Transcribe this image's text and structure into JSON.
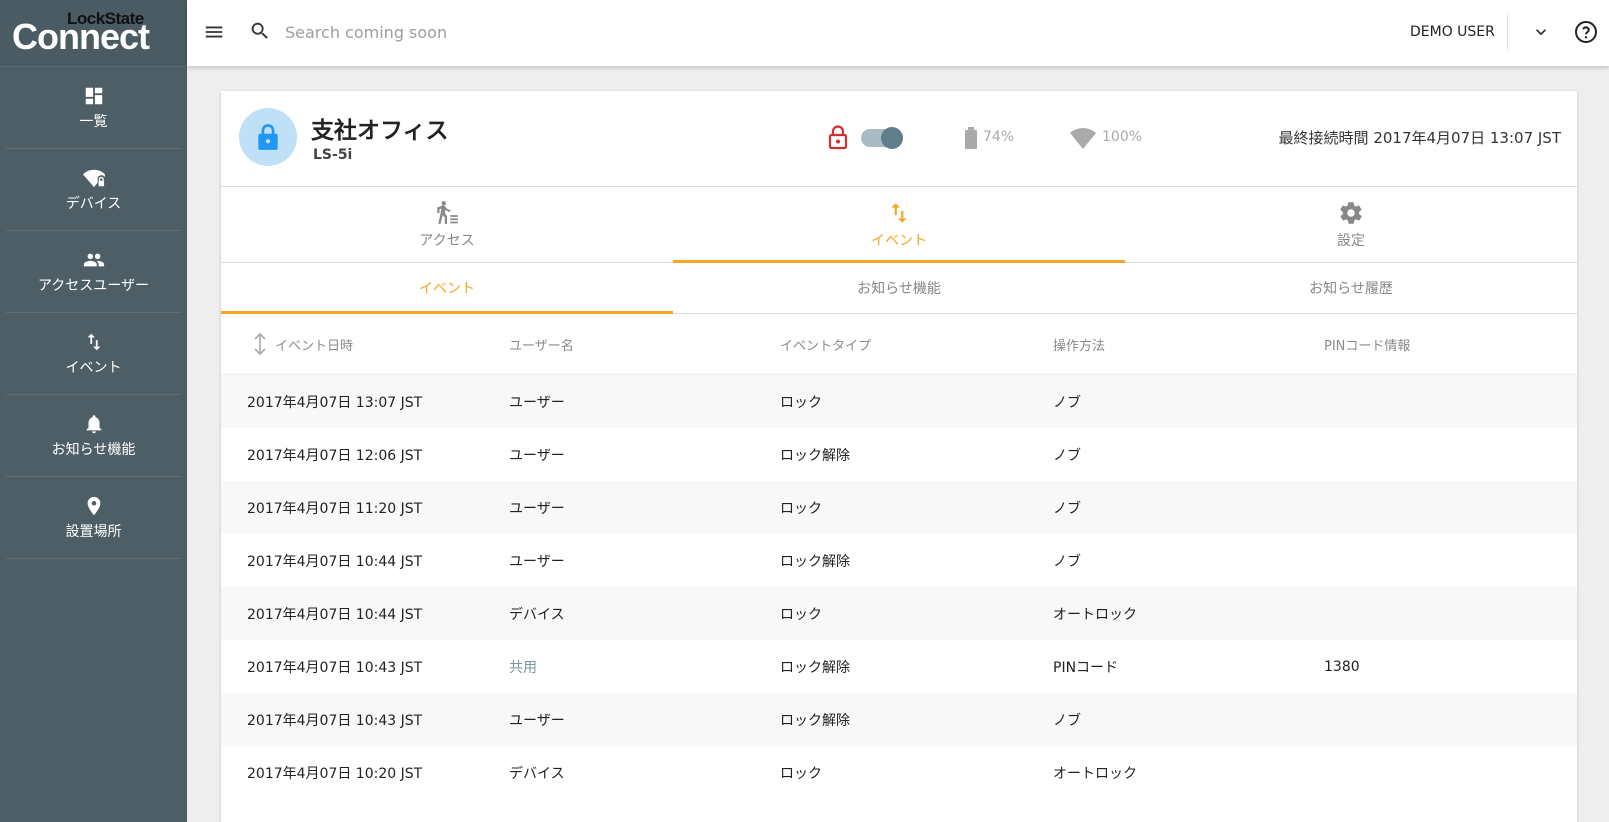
{
  "app": {
    "logo_top": "LockState",
    "logo_main": "Connect"
  },
  "sidebar": {
    "items": [
      {
        "label": "一覧",
        "icon": "dashboard-icon"
      },
      {
        "label": "デバイス",
        "icon": "wifi-lock-icon"
      },
      {
        "label": "アクセスユーザー",
        "icon": "people-icon"
      },
      {
        "label": "イベント",
        "icon": "swap-vert-icon"
      },
      {
        "label": "お知らせ機能",
        "icon": "bell-icon"
      },
      {
        "label": "設置場所",
        "icon": "location-pin-icon"
      }
    ]
  },
  "topbar": {
    "search_placeholder": "Search coming soon",
    "user": "DEMO USER"
  },
  "device": {
    "name": "支社オフィス",
    "model": "LS-5i",
    "battery": "74%",
    "signal": "100%",
    "last_connection": "最終接続時間 2017年4月07日 13:07 JST",
    "locked": true
  },
  "main_tabs": [
    {
      "label": "アクセス",
      "icon": "person-access-icon",
      "active": false
    },
    {
      "label": "イベント",
      "icon": "swap-vert-icon",
      "active": true
    },
    {
      "label": "設定",
      "icon": "gear-icon",
      "active": false
    }
  ],
  "sub_tabs": [
    {
      "label": "イベント",
      "active": true
    },
    {
      "label": "お知らせ機能",
      "active": false
    },
    {
      "label": "お知らせ履歴",
      "active": false
    }
  ],
  "table": {
    "columns": [
      "イベント日時",
      "ユーザー名",
      "イベントタイプ",
      "操作方法",
      "PINコード情報"
    ],
    "rows": [
      [
        "2017年4月07日 13:07 JST",
        "ユーザー",
        "ロック",
        "ノブ",
        ""
      ],
      [
        "2017年4月07日 12:06 JST",
        "ユーザー",
        "ロック解除",
        "ノブ",
        ""
      ],
      [
        "2017年4月07日 11:20 JST",
        "ユーザー",
        "ロック",
        "ノブ",
        ""
      ],
      [
        "2017年4月07日 10:44 JST",
        "ユーザー",
        "ロック解除",
        "ノブ",
        ""
      ],
      [
        "2017年4月07日 10:44 JST",
        "デバイス",
        "ロック",
        "オートロック",
        ""
      ],
      [
        "2017年4月07日 10:43 JST",
        "共用",
        "ロック解除",
        "PINコード",
        "1380"
      ],
      [
        "2017年4月07日 10:43 JST",
        "ユーザー",
        "ロック解除",
        "ノブ",
        ""
      ],
      [
        "2017年4月07日 10:20 JST",
        "デバイス",
        "ロック",
        "オートロック",
        ""
      ]
    ]
  },
  "colors": {
    "sidebar": "#4d5e66",
    "accent": "#f5a623",
    "lock_red": "#d32f2f",
    "link": "#7a94a3"
  }
}
